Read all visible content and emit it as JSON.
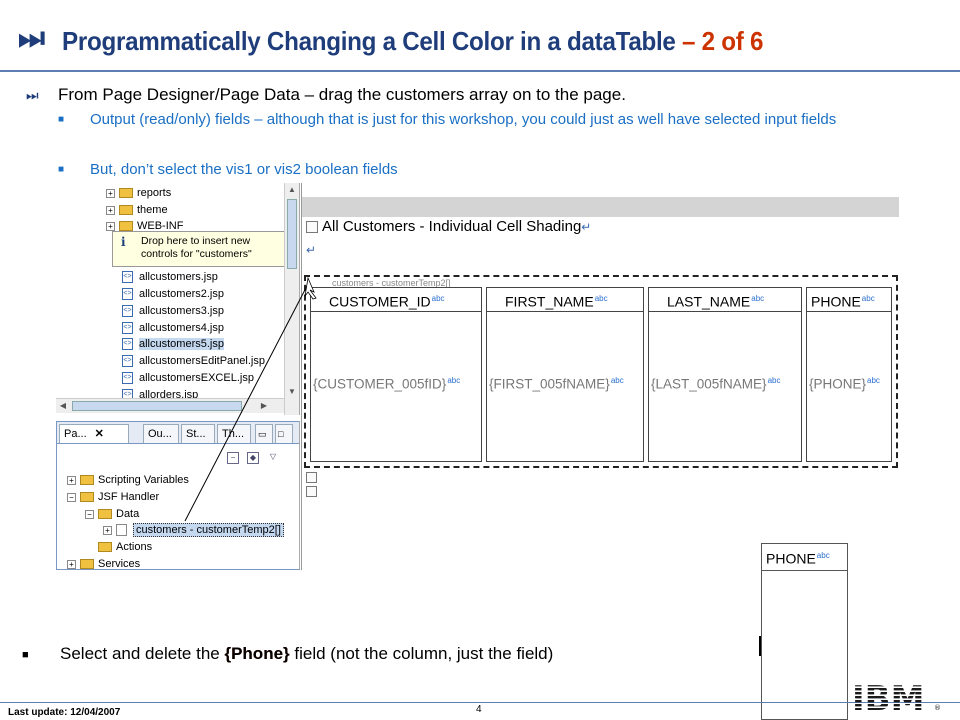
{
  "title": {
    "main": "Programmatically Changing a Cell Color in a dataTable",
    "suffix": "– 2 of 6"
  },
  "bullets": {
    "main": "From Page Designer/Page Data – drag the customers array on to the page.",
    "sub1": "Output (read/only) fields – although that is just for this workshop, you could just as well have selected input fields",
    "sub2": "But, don’t select the vis1 or vis2 boolean fields",
    "bottom_pre": "Select and delete the ",
    "bottom_field": "{Phone}",
    "bottom_post": " field (not the column, just the field)"
  },
  "tree": {
    "folders": [
      "reports",
      "theme",
      "WEB-INF"
    ],
    "tooltip": "Drop here to insert new controls for \"customers\"",
    "files": [
      "allcustomers.jsp",
      "allcustomers2.jsp",
      "allcustomers3.jsp",
      "allcustomers4.jsp",
      "allcustomers5.jsp",
      "allcustomersEditPanel.jsp",
      "allcustomersEXCEL.jsp",
      "allorders.jsp"
    ]
  },
  "data_panel": {
    "tabs": [
      "Pa...",
      "Ou...",
      "St...",
      "Th..."
    ],
    "items": [
      "Scripting Variables",
      "JSF Handler",
      "Data",
      "customers - customerTemp2[]",
      "Actions",
      "Services"
    ]
  },
  "editor": {
    "heading": "All Customers - Individual Cell Shading",
    "table_caption": "customers - customerTemp2[]",
    "abc": "abc",
    "columns": [
      {
        "header": "CUSTOMER_ID",
        "value": "{CUSTOMER_005fID}"
      },
      {
        "header": "FIRST_NAME",
        "value": "{FIRST_005fNAME}"
      },
      {
        "header": "LAST_NAME",
        "value": "{LAST_005fNAME}"
      },
      {
        "header": "PHONE",
        "value": "{PHONE}"
      }
    ]
  },
  "phone_inset": {
    "header": "PHONE",
    "abc": "abc"
  },
  "footer": {
    "last_update": "Last update: 12/04/2007",
    "page": "4",
    "logo_text": "IBM"
  },
  "colors": {
    "title_blue": "#1f3d7a",
    "accent_red": "#cc3300",
    "sub_blue": "#1a6fc4"
  }
}
